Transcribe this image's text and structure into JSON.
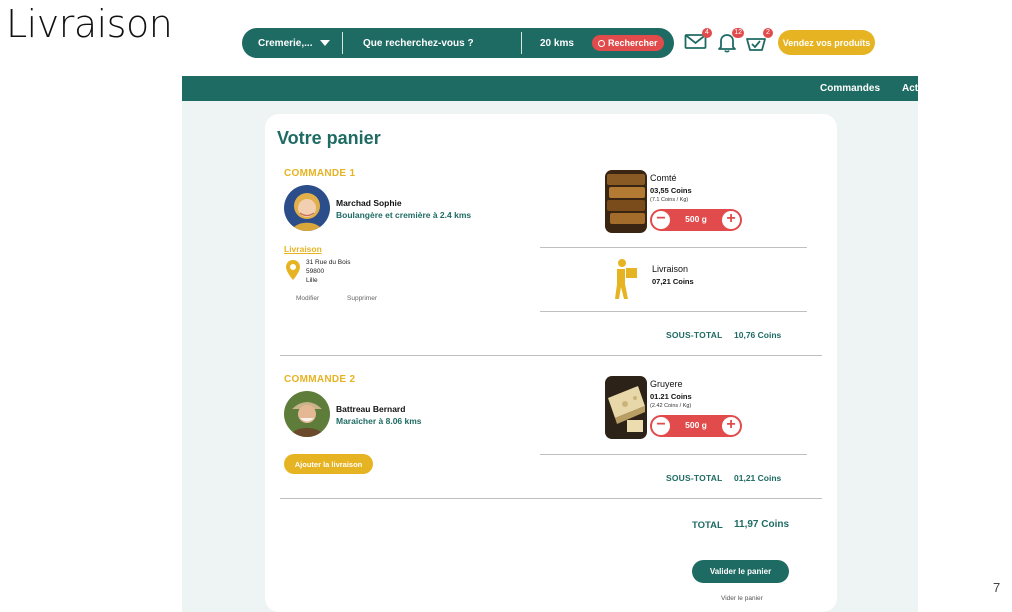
{
  "slide": {
    "title": "Livraison",
    "number": "7"
  },
  "search": {
    "category": "Cremerie,...",
    "query_placeholder": "Que recherchez-vous ?",
    "distance": "20 kms",
    "button_label": "Rechercher"
  },
  "header_icons": {
    "mail_count": "4",
    "notif_count": "12",
    "cart_count": "2"
  },
  "sell_button": "Vendez vos produits",
  "nav": {
    "commandes": "Commandes",
    "act": "Act"
  },
  "cart": {
    "title": "Votre panier",
    "orders": [
      {
        "title": "COMMANDE 1",
        "seller_name": "Marchad Sophie",
        "seller_desc": "Boulangère et cremière à 2.4 kms",
        "delivery_link": "Livraison",
        "address": [
          "31 Rue du Bois",
          "59800",
          "Lille"
        ],
        "modify_label": "Modifier",
        "delete_label": "Supprimer",
        "product": {
          "name": "Comté",
          "price": "03,55 Coins",
          "unit": "(7.1 Coins / Kg)",
          "qty": "500 g"
        },
        "delivery": {
          "name": "Livraison",
          "price": "07,21 Coins"
        },
        "subtotal_label": "SOUS-TOTAL",
        "subtotal": "10,76 Coins"
      },
      {
        "title": "COMMANDE 2",
        "seller_name": "Battreau Bernard",
        "seller_desc": "Maraîcher à 8.06 kms",
        "add_delivery_label": "Ajouter la livraison",
        "product": {
          "name": "Gruyere",
          "price": "01.21 Coins",
          "unit": "(2.42 Coins / Kg)",
          "qty": "500 g"
        },
        "subtotal_label": "SOUS-TOTAL",
        "subtotal": "01,21 Coins"
      }
    ],
    "total_label": "TOTAL",
    "total": "11,97 Coins",
    "validate_label": "Valider le panier",
    "empty_label": "Vider le panier"
  },
  "colors": {
    "primary": "#1e6b63",
    "accent": "#e6b322",
    "danger": "#e24b4b",
    "bg": "#eef4f3"
  }
}
